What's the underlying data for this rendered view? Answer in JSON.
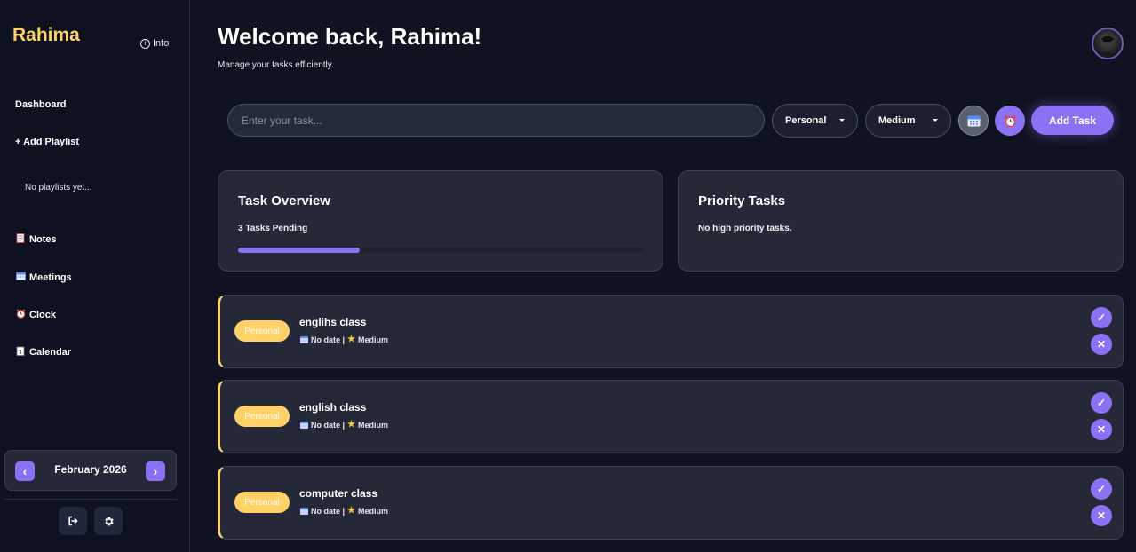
{
  "sidebar": {
    "brand": "Rahima",
    "info_label": "Info",
    "dashboard": "Dashboard",
    "add_playlist": "+ Add Playlist",
    "no_playlists": "No playlists yet...",
    "items": [
      {
        "icon": "notes-icon",
        "label": "Notes"
      },
      {
        "icon": "meetings-icon",
        "label": "Meetings"
      },
      {
        "icon": "clock-icon",
        "label": "Clock"
      },
      {
        "icon": "calendar-icon",
        "label": "Calendar"
      }
    ],
    "month_label": "February 2026",
    "prev_glyph": "‹",
    "next_glyph": "›"
  },
  "header": {
    "title": "Welcome back, Rahima!",
    "subtitle": "Manage your tasks efficiently."
  },
  "task_form": {
    "placeholder": "Enter your task...",
    "category": "Personal",
    "priority": "Medium",
    "add_label": "Add Task"
  },
  "overview": {
    "title": "Task Overview",
    "pending": "3 Tasks Pending",
    "progress_fraction": 0.3
  },
  "priority": {
    "title": "Priority Tasks",
    "text": "No high priority tasks."
  },
  "tasks": [
    {
      "tag": "Personal",
      "name": "englihs class",
      "date": "No date |",
      "priority": "Medium"
    },
    {
      "tag": "Personal",
      "name": "english class",
      "date": "No date |",
      "priority": "Medium"
    },
    {
      "tag": "Personal",
      "name": "computer class",
      "date": "No date |",
      "priority": "Medium"
    }
  ],
  "colors": {
    "accent": "#8b72f5",
    "brand": "#ffd166",
    "background": "#0f1221",
    "card": "#252836"
  }
}
